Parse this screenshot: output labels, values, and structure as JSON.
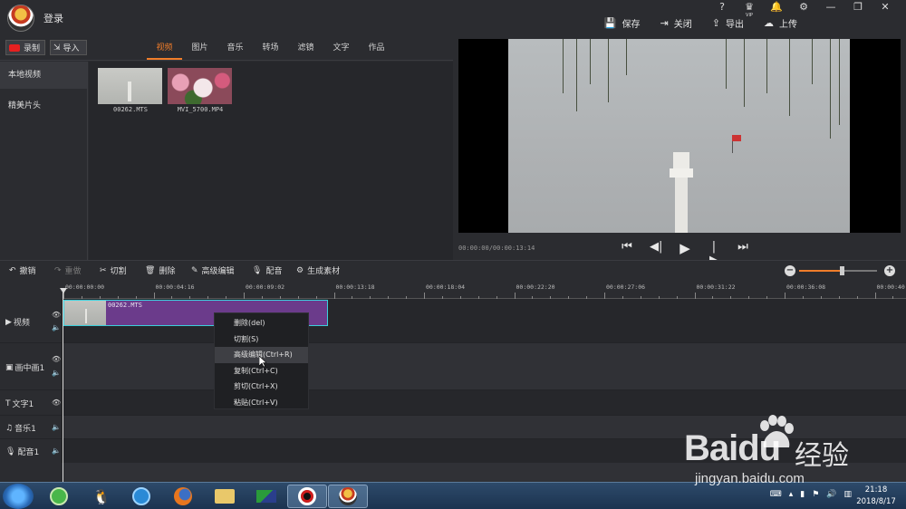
{
  "app": {
    "login_label": "登录",
    "window_controls": [
      "?",
      "VIP",
      "bell",
      "gear",
      "minimize",
      "restore",
      "close"
    ],
    "vip_label": "VIP"
  },
  "top_actions": [
    {
      "icon": "save-icon",
      "label": "保存"
    },
    {
      "icon": "exit-icon",
      "label": "关闭"
    },
    {
      "icon": "export-icon",
      "label": "导出"
    },
    {
      "icon": "cloud-upload-icon",
      "label": "上传"
    }
  ],
  "media_toolbar": {
    "record_label": "录制",
    "import_label": "导入",
    "tabs": [
      "视频",
      "图片",
      "音乐",
      "转场",
      "滤镜",
      "文字",
      "作品"
    ],
    "active_tab": "视频"
  },
  "sidebar": {
    "items": [
      "本地视频",
      "精美片头"
    ],
    "active": "本地视频"
  },
  "media_items": [
    {
      "name": "00262.MTS"
    },
    {
      "name": "MVI_5700.MP4"
    }
  ],
  "preview": {
    "timecode": "00:00:00/00:00:13:14"
  },
  "timeline_toolbar": {
    "buttons": [
      {
        "icon": "undo-icon",
        "label": "撤销",
        "enabled": true
      },
      {
        "icon": "redo-icon",
        "label": "重做",
        "enabled": false
      },
      {
        "icon": "cut-icon",
        "label": "切割",
        "enabled": true
      },
      {
        "icon": "delete-icon",
        "label": "删除",
        "enabled": true
      },
      {
        "icon": "edit-icon",
        "label": "高级编辑",
        "enabled": true
      },
      {
        "icon": "mic-icon",
        "label": "配音",
        "enabled": true
      },
      {
        "icon": "generate-icon",
        "label": "生成素材",
        "enabled": true
      }
    ],
    "zoom_level": 0.55
  },
  "ruler": {
    "labels": [
      "00:00:00:00",
      "00:00:04:16",
      "00:00:09:02",
      "00:00:13:18",
      "00:00:18:04",
      "00:00:22:20",
      "00:00:27:06",
      "00:00:31:22",
      "00:00:36:08",
      "00:00:40"
    ]
  },
  "tracks": [
    {
      "name": "视频",
      "icon": "video-track-icon"
    },
    {
      "name": "画中画1",
      "icon": "pip-track-icon"
    },
    {
      "name": "文字1",
      "icon": "text-track-icon"
    },
    {
      "name": "音乐1",
      "icon": "music-track-icon"
    },
    {
      "name": "配音1",
      "icon": "mic-track-icon"
    }
  ],
  "clip": {
    "name": "00262.MTS"
  },
  "context_menu": {
    "items": [
      "删除(del)",
      "切割(S)",
      "高级编辑(Ctrl+R)",
      "复制(Ctrl+C)",
      "剪切(Ctrl+X)",
      "粘贴(Ctrl+V)"
    ],
    "hovered": "高级编辑(Ctrl+R)"
  },
  "taskbar": {
    "time": "21:18",
    "date": "2018/8/17"
  },
  "watermark": {
    "brand": "Baidu",
    "cn": "经验",
    "url": "jingyan.baidu.com"
  }
}
